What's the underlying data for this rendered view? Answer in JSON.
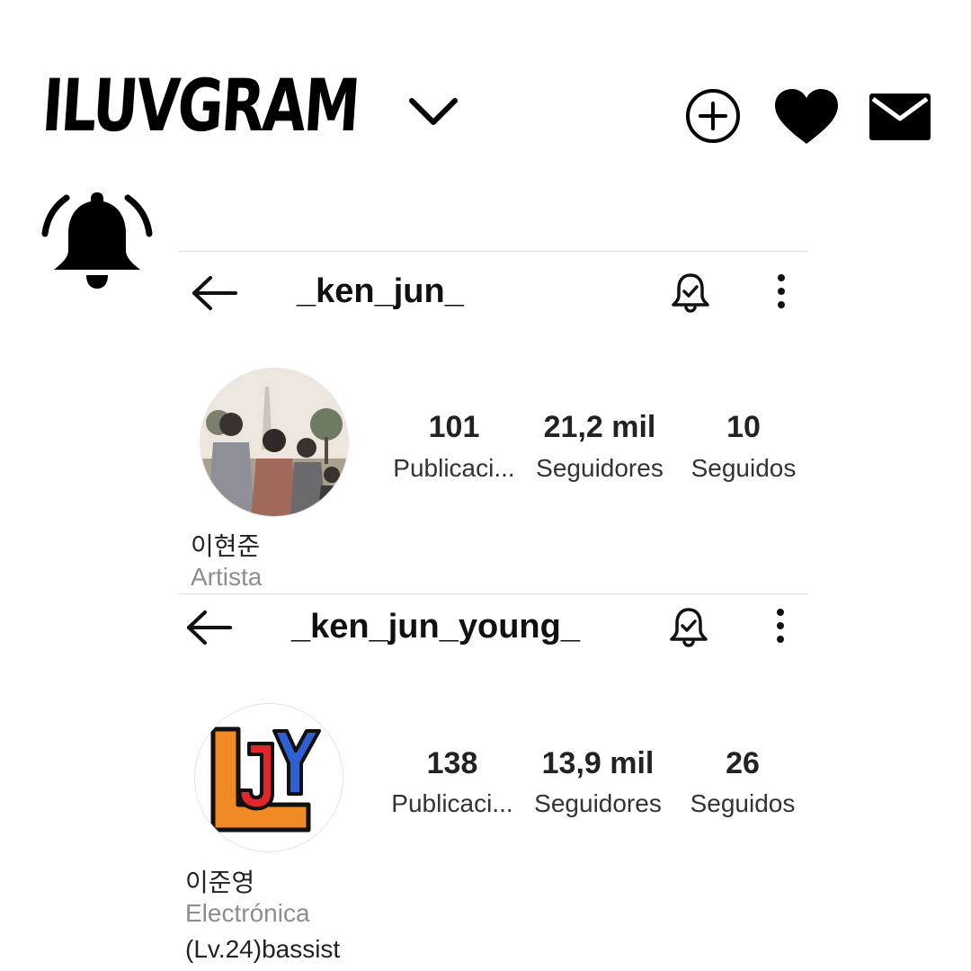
{
  "header": {
    "title": "ILUVGRAM",
    "icons": [
      "chevron-down-icon",
      "add-circle-icon",
      "heart-icon",
      "mail-icon",
      "bell-ringing-icon"
    ]
  },
  "profiles": [
    {
      "username": "_ken_jun_",
      "name": "이현준",
      "category": "Artista",
      "stats": [
        {
          "value": "101",
          "label": "Publicaci..."
        },
        {
          "value": "21,2 mil",
          "label": "Seguidores"
        },
        {
          "value": "10",
          "label": "Seguidos"
        }
      ]
    },
    {
      "username": "_ken_jun_young_",
      "name": "이준영",
      "category": "Electrónica",
      "bio": "(Lv.24)bassist",
      "avatar_logo": "JY",
      "stats": [
        {
          "value": "138",
          "label": "Publicaci..."
        },
        {
          "value": "13,9 mil",
          "label": "Seguidores"
        },
        {
          "value": "26",
          "label": "Seguidos"
        }
      ]
    }
  ]
}
